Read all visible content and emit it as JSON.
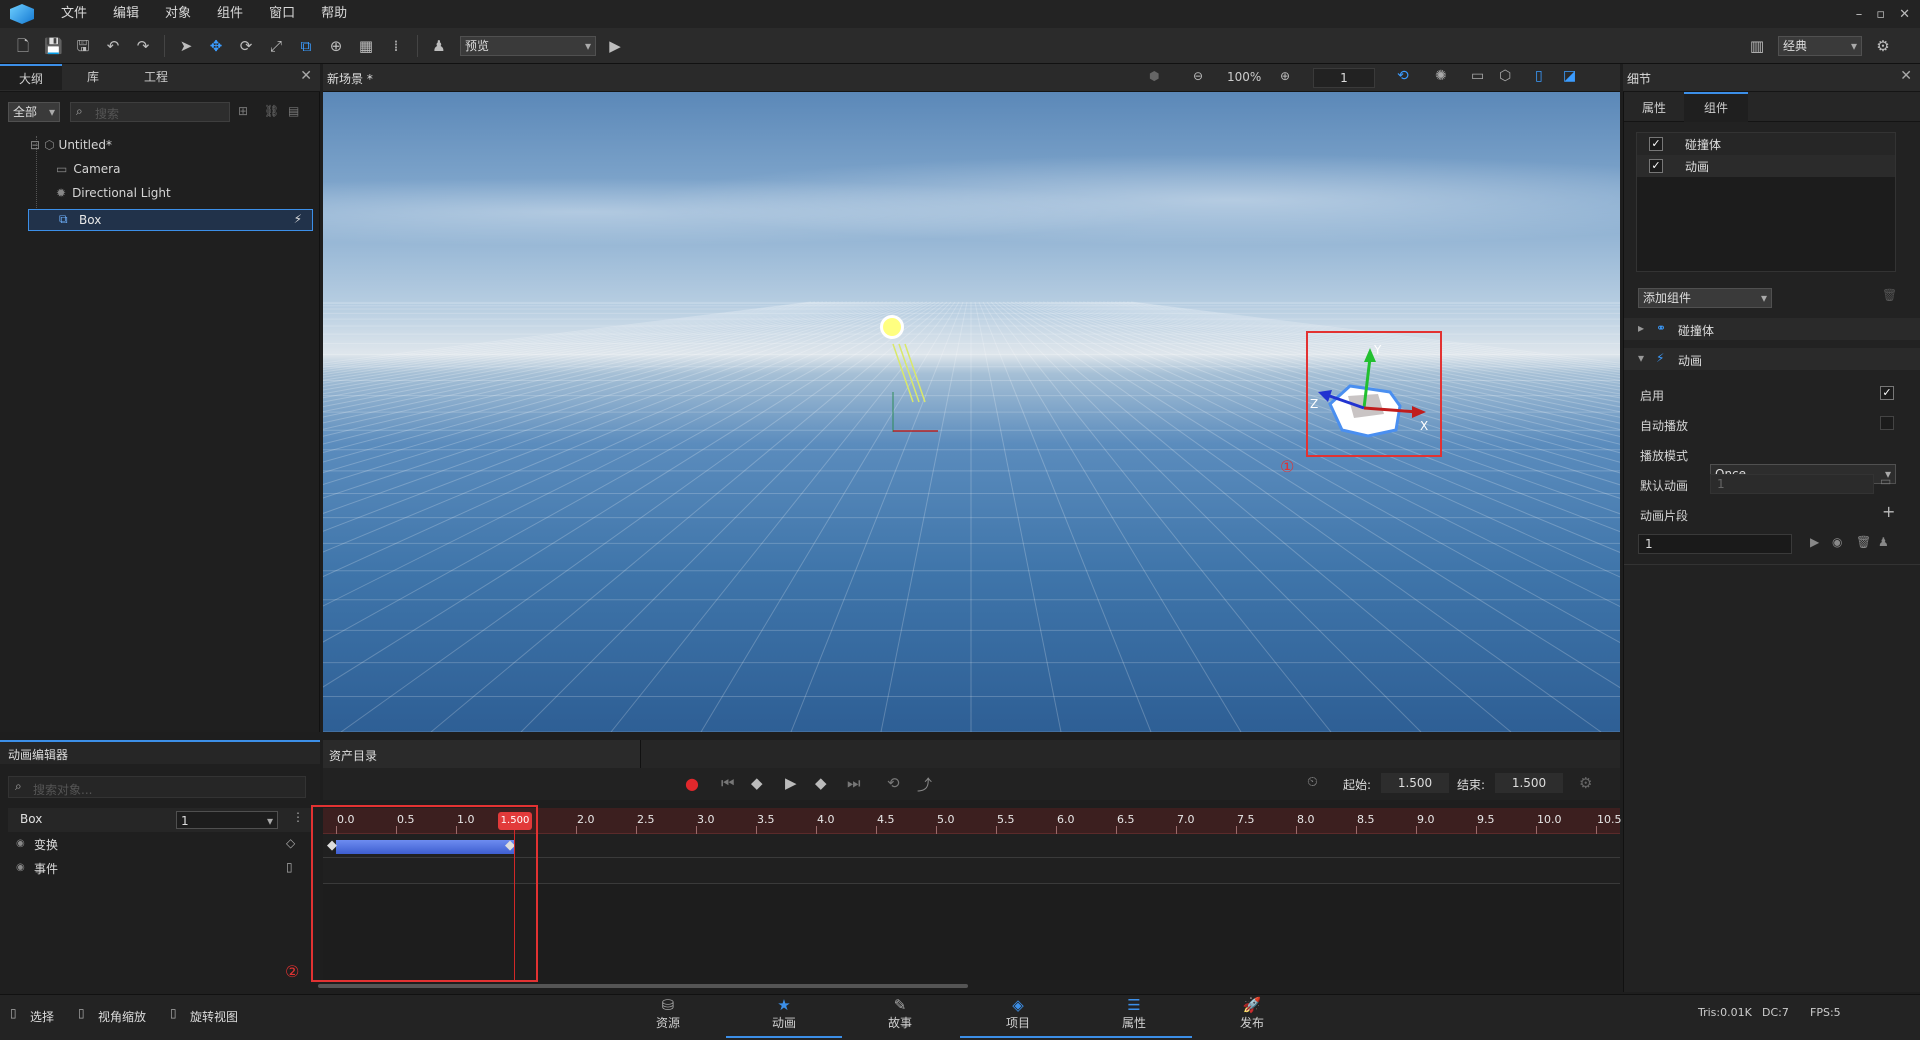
{
  "menu": [
    "文件",
    "编辑",
    "对象",
    "组件",
    "窗口",
    "帮助"
  ],
  "window_controls": [
    "–",
    "▫",
    "✕"
  ],
  "toolbar": {
    "preview_label": "预览",
    "layout_label": "经典"
  },
  "left_panel": {
    "tabs": [
      "大纲",
      "库",
      "工程"
    ],
    "filter": "全部",
    "search_placeholder": "搜索",
    "tree": [
      {
        "label": "Untitled*",
        "icon": "scene-icon"
      },
      {
        "label": "Camera",
        "icon": "camera-icon"
      },
      {
        "label": "Directional Light",
        "icon": "light-icon"
      },
      {
        "label": "Box",
        "icon": "box-icon",
        "selected": true
      }
    ]
  },
  "viewport": {
    "title": "新场景 *",
    "zoom": "100%",
    "frame": "1"
  },
  "right_panel": {
    "title": "细节",
    "tabs": [
      "属性",
      "组件"
    ],
    "components": [
      {
        "label": "碰撞体",
        "checked": true
      },
      {
        "label": "动画",
        "checked": true
      }
    ],
    "add_component": "添加组件",
    "sections": [
      "碰撞体",
      "动画"
    ],
    "props": {
      "enable": "启用",
      "enable_checked": true,
      "autoplay": "自动播放",
      "autoplay_checked": false,
      "play_mode": "播放模式",
      "play_mode_value": "Once",
      "default_anim": "默认动画",
      "default_anim_value": "1",
      "clips": "动画片段",
      "clip_value": "1"
    }
  },
  "annotations": {
    "one": "①",
    "two": "②"
  },
  "anim_editor": {
    "title": "动画编辑器",
    "asset_tab": "资产目录",
    "search_placeholder": "搜索对象...",
    "object": "Box",
    "clip": "1",
    "tracks": [
      "变换",
      "事件"
    ],
    "start_label": "起始:",
    "start_value": "1.500",
    "end_label": "结束:",
    "end_value": "1.500",
    "playhead": "1.500",
    "ticks": [
      "0.0",
      "0.5",
      "1.0",
      "1.5",
      "2.0",
      "2.5",
      "3.0",
      "3.5",
      "4.0",
      "4.5",
      "5.0",
      "5.5",
      "6.0",
      "6.5",
      "7.0",
      "7.5",
      "8.0",
      "8.5",
      "9.0",
      "9.5",
      "10.0",
      "10.5"
    ]
  },
  "bottom_bar": {
    "tools": [
      "选择",
      "视角缩放",
      "旋转视图"
    ],
    "tabs": [
      "资源",
      "动画",
      "故事",
      "项目",
      "属性",
      "发布"
    ],
    "stats": [
      "Tris:0.01K",
      "DC:7",
      "FPS:5"
    ]
  },
  "colors": {
    "accent": "#3c8fe8",
    "record": "#e0282c",
    "highlight": "#e23232"
  }
}
